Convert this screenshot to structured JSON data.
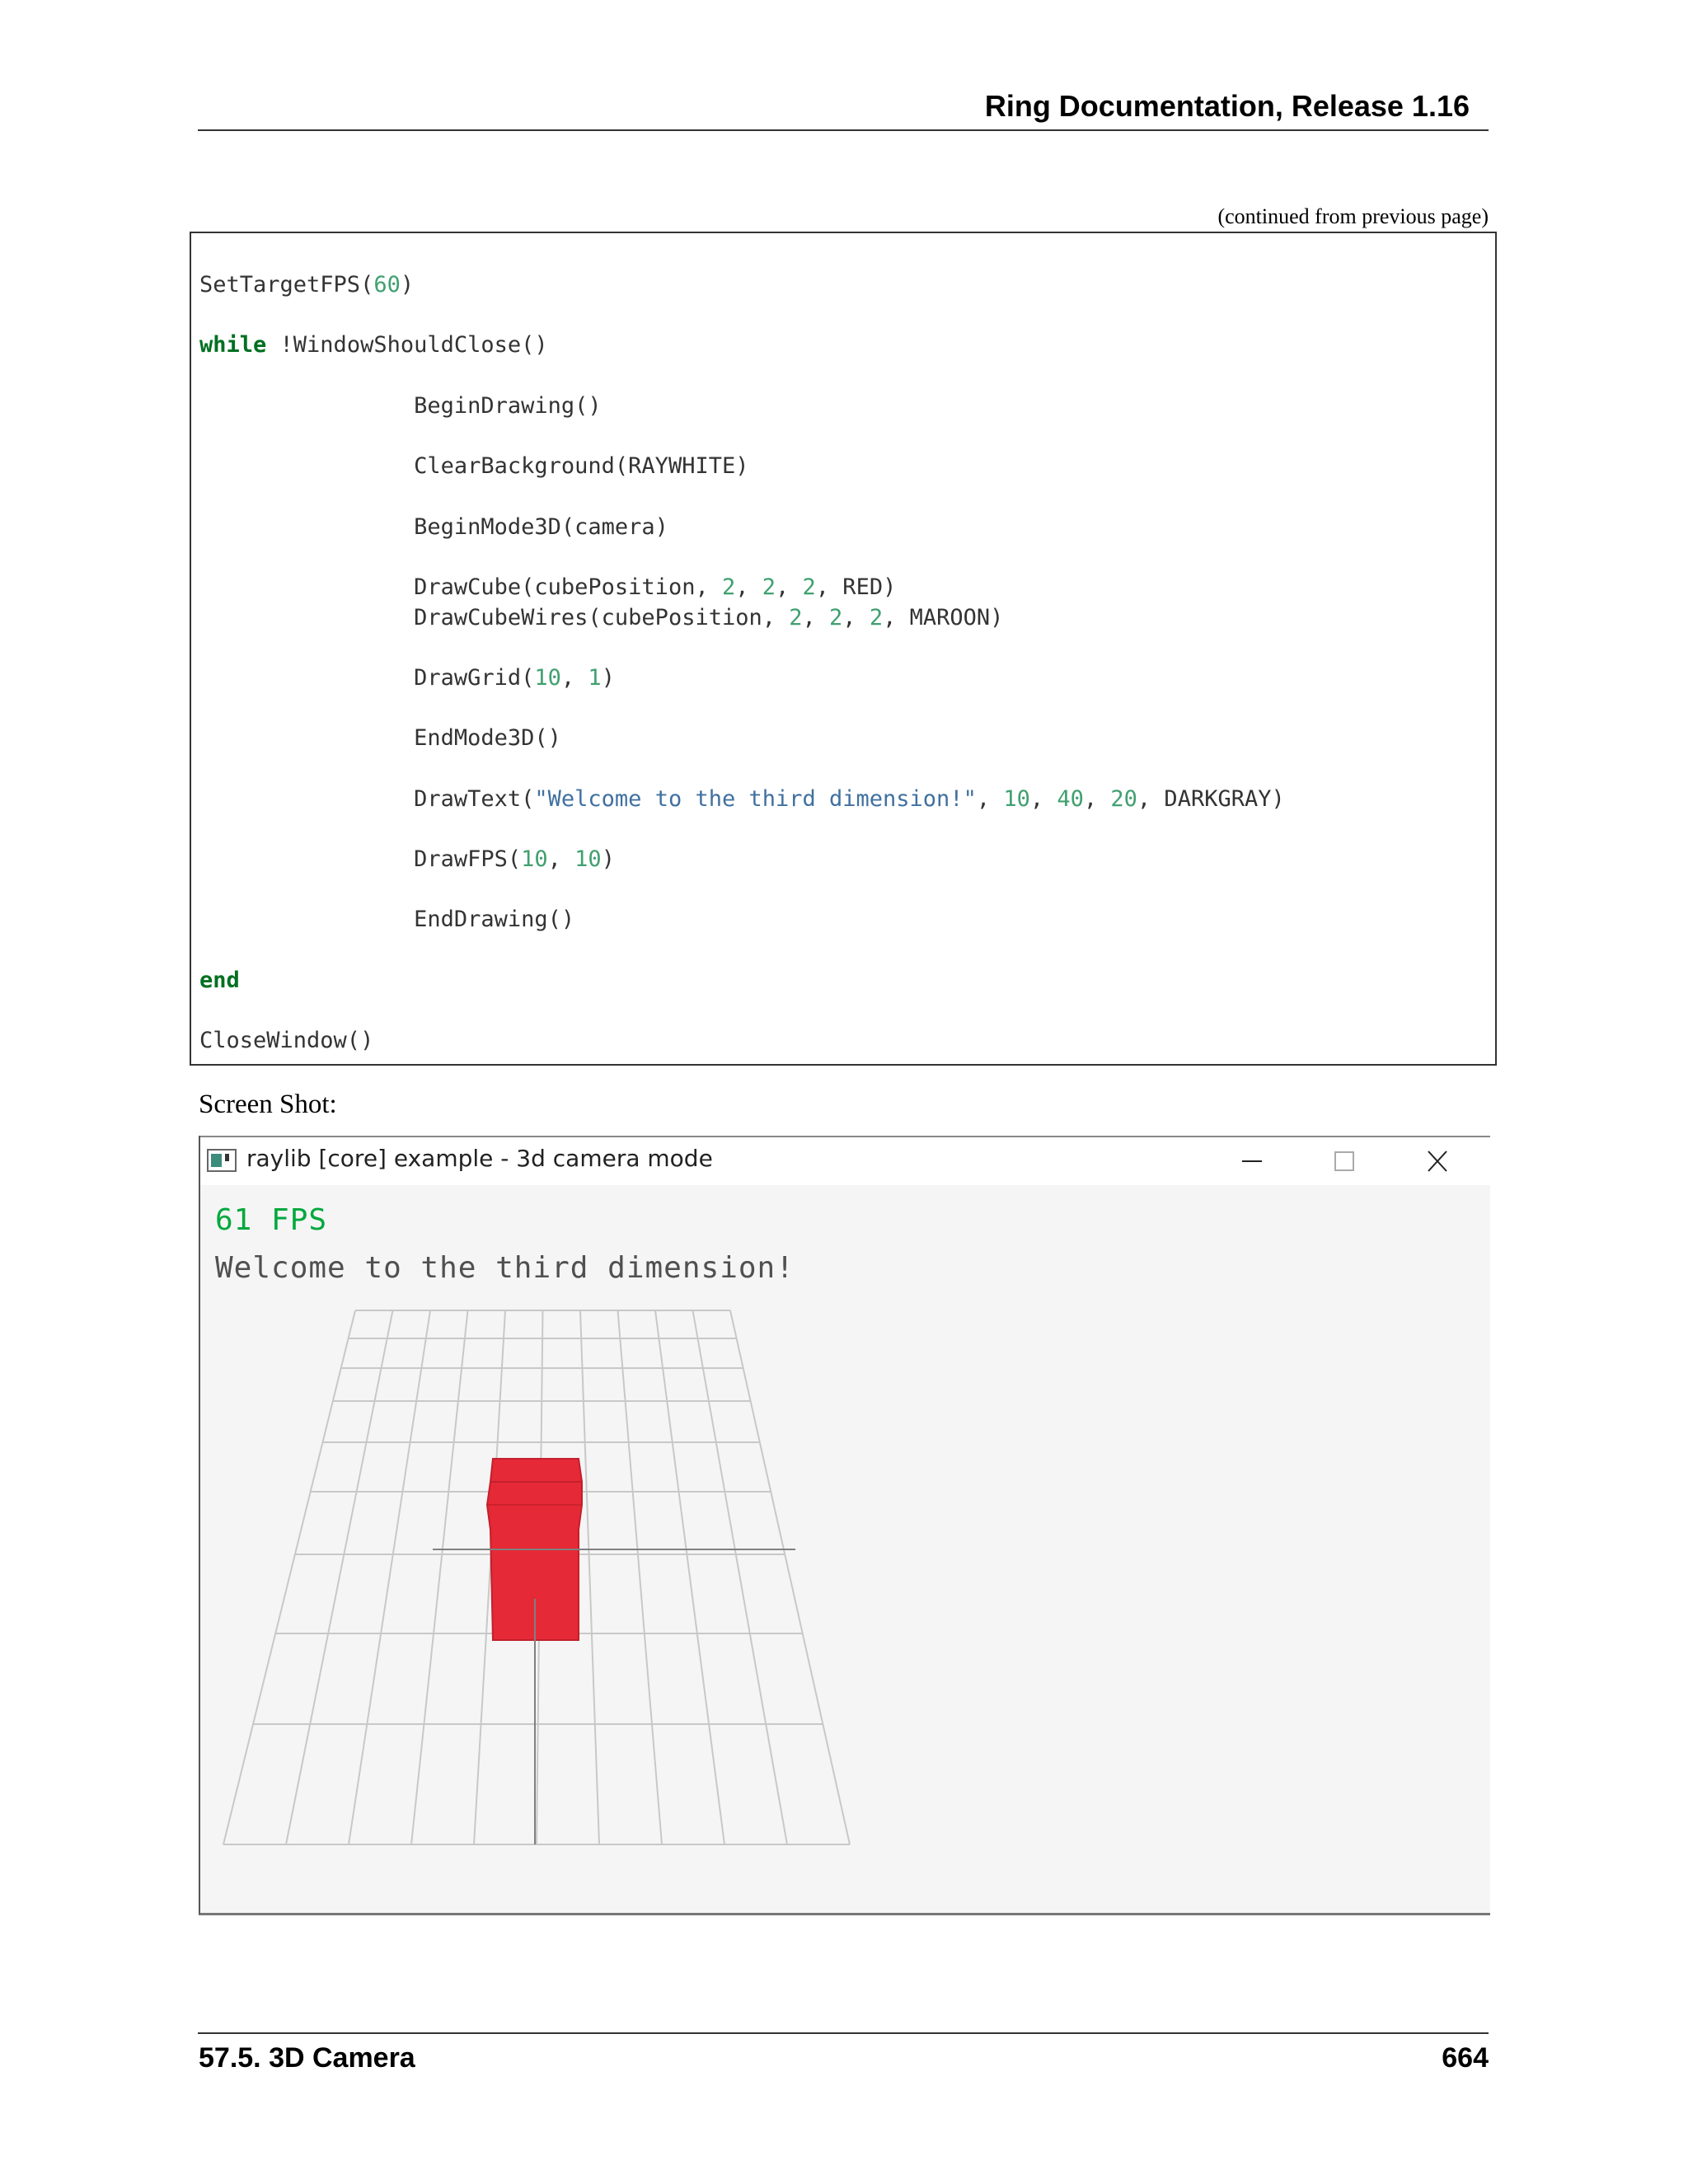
{
  "header": {
    "title": "Ring Documentation, Release 1.16"
  },
  "continued_note": "(continued from previous page)",
  "code": {
    "lines": [
      [
        {
          "t": "SetTargetFPS("
        },
        {
          "t": "60",
          "c": "num"
        },
        {
          "t": ")"
        }
      ],
      [],
      [
        {
          "t": "while",
          "c": "kw"
        },
        {
          "t": " !WindowShouldClose()"
        }
      ],
      [],
      [
        {
          "t": "                BeginDrawing()"
        }
      ],
      [],
      [
        {
          "t": "                ClearBackground(RAYWHITE)"
        }
      ],
      [],
      [
        {
          "t": "                BeginMode3D(camera)"
        }
      ],
      [],
      [
        {
          "t": "                DrawCube(cubePosition, "
        },
        {
          "t": "2",
          "c": "num"
        },
        {
          "t": ", "
        },
        {
          "t": "2",
          "c": "num"
        },
        {
          "t": ", "
        },
        {
          "t": "2",
          "c": "num"
        },
        {
          "t": ", RED)"
        }
      ],
      [
        {
          "t": "                DrawCubeWires(cubePosition, "
        },
        {
          "t": "2",
          "c": "num"
        },
        {
          "t": ", "
        },
        {
          "t": "2",
          "c": "num"
        },
        {
          "t": ", "
        },
        {
          "t": "2",
          "c": "num"
        },
        {
          "t": ", MAROON)"
        }
      ],
      [],
      [
        {
          "t": "                DrawGrid("
        },
        {
          "t": "10",
          "c": "num"
        },
        {
          "t": ", "
        },
        {
          "t": "1",
          "c": "num"
        },
        {
          "t": ")"
        }
      ],
      [],
      [
        {
          "t": "                EndMode3D()"
        }
      ],
      [],
      [
        {
          "t": "                DrawText("
        },
        {
          "t": "\"Welcome to the third dimension!\"",
          "c": "str"
        },
        {
          "t": ", "
        },
        {
          "t": "10",
          "c": "num"
        },
        {
          "t": ", "
        },
        {
          "t": "40",
          "c": "num"
        },
        {
          "t": ", "
        },
        {
          "t": "20",
          "c": "num"
        },
        {
          "t": ", DARKGRAY)"
        }
      ],
      [],
      [
        {
          "t": "                DrawFPS("
        },
        {
          "t": "10",
          "c": "num"
        },
        {
          "t": ", "
        },
        {
          "t": "10",
          "c": "num"
        },
        {
          "t": ")"
        }
      ],
      [],
      [
        {
          "t": "                EndDrawing()"
        }
      ],
      [],
      [
        {
          "t": "end",
          "c": "kw"
        }
      ],
      [],
      [
        {
          "t": "CloseWindow()"
        }
      ]
    ]
  },
  "screenshot_label": "Screen Shot:",
  "window": {
    "title": "raylib [core] example - 3d camera mode",
    "icon": "app-window-icon",
    "controls": [
      "minimize-icon",
      "maximize-icon",
      "close-icon"
    ],
    "fps_text": "61 FPS",
    "welcome_text": "Welcome to the third dimension!",
    "colors": {
      "fps": "#00a83c",
      "text": "#505050",
      "cube": "#e62937",
      "grid": "#c8c8c8",
      "axis": "#808080",
      "background": "#f5f5f5"
    }
  },
  "footer": {
    "section": "57.5.  3D Camera",
    "page": "664"
  }
}
